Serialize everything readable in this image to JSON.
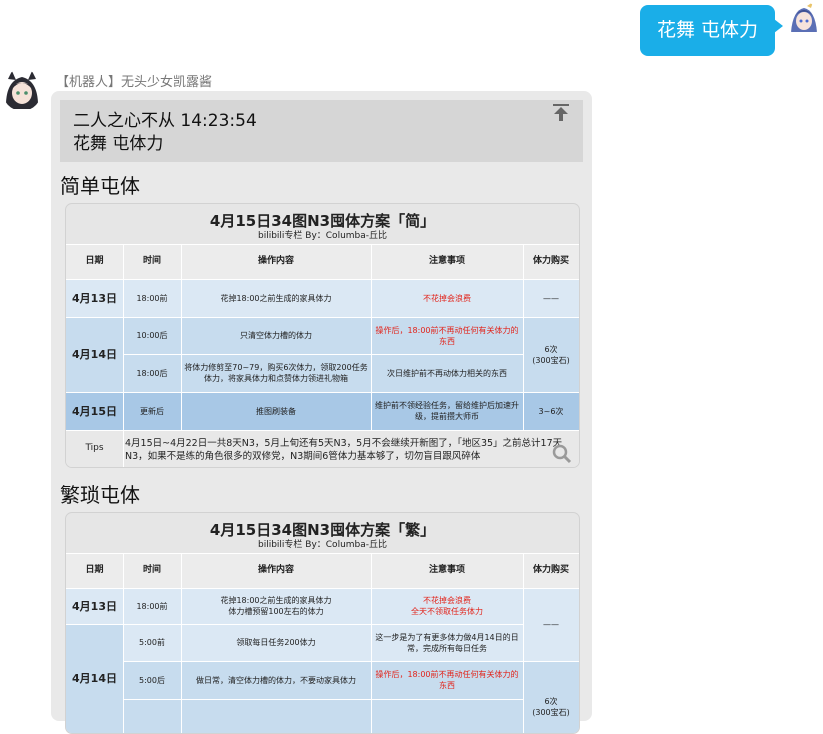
{
  "user_message": {
    "text": "花舞 屯体力"
  },
  "bot": {
    "name": "【机器人】无头少女凯露酱",
    "quote_line1": "二人之心不从    14:23:54",
    "quote_line2": "花舞 屯体力",
    "section1_title": "简单屯体",
    "section2_title": "繁琐屯体"
  },
  "card1": {
    "title": "4月15日34图N3囤体方案「简」",
    "subtitle": "bilibili专栏  By：Columba-丘比",
    "headers": [
      "日期",
      "时间",
      "操作内容",
      "注意事项",
      "体力购买"
    ],
    "rows": [
      {
        "date": "4月13日",
        "time": "18:00前",
        "op": "花掉18:00之前生成的家具体力",
        "note": "不花掉会浪费",
        "buy": "——"
      },
      {
        "date": "4月14日",
        "time": "10:00后",
        "op": "只清空体力槽的体力",
        "note": "操作后，18:00前不再动任何有关体力的东西",
        "buy": "6次\n(300宝石)"
      },
      {
        "time": "18:00后",
        "op": "将体力修剪至70~79，购买6次体力，领取200任务体力，将家具体力和点赞体力领进礼物箱",
        "note": "次日维护前不再动体力相关的东西"
      },
      {
        "date": "4月15日",
        "time": "更新后",
        "op": "推图刷装备",
        "note": "维护前不领经验任务，留给维护后加速升级，提前攒大师币",
        "buy": "3~6次"
      }
    ],
    "tips_label": "Tips",
    "tips_text": "4月15日~4月22日一共8天N3，5月上旬还有5天N3，5月不会继续开新图了，「地区35」之前总计17天N3，如果不是练的角色很多的双修党，N3期间6管体力基本够了，切勿盲目跟风碎体"
  },
  "card2": {
    "title": "4月15日34图N3囤体方案「繁」",
    "subtitle": "bilibili专栏  By：Columba-丘比",
    "headers": [
      "日期",
      "时间",
      "操作内容",
      "注意事项",
      "体力购买"
    ],
    "rows": [
      {
        "date": "4月13日",
        "time": "18:00前",
        "op": "花掉18:00之前生成的家具体力\n体力槽预留100左右的体力",
        "note": "不花掉会浪费\n全天不领取任务体力",
        "buy": "——"
      },
      {
        "date": "4月14日",
        "time": "5:00前",
        "op": "领取每日任务200体力",
        "note": "这一步是为了有更多体力做4月14日的日常，完成所有每日任务"
      },
      {
        "time": "5:00后",
        "op": "做日常，清空体力槽的体力，不要动家具体力",
        "note": "操作后，18:00前不再动任何有关体力的东西",
        "buy": "6次\n(300宝石)"
      }
    ]
  }
}
